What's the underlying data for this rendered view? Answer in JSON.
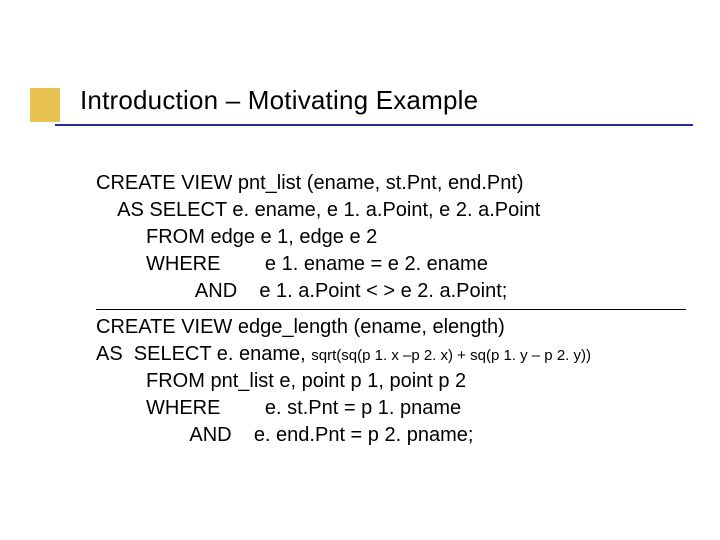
{
  "title": "Introduction – Motivating Example",
  "lines": {
    "l1": "CREATE VIEW pnt_list (ename, st.Pnt, end.Pnt)",
    "l2": "    AS SELECT e. ename, e 1. a.Point, e 2. a.Point",
    "l3": "         FROM edge e 1, edge e 2",
    "l4": "         WHERE        e 1. ename = e 2. ename",
    "l5": "                  AND    e 1. a.Point < > e 2. a.Point;",
    "l6a": "CREATE VIEW edge_length (ename, elength)",
    "l6b_prefix": "AS  SELECT e. ename, ",
    "l6b_small": "sqrt(sq(p 1. x –p 2. x) + sq(p 1. y – p 2. y))",
    "l7": "         FROM pnt_list e, point p 1, point p 2",
    "l8": "         WHERE        e. st.Pnt = p 1. pname",
    "l9": "                 AND    e. end.Pnt = p 2. pname;"
  }
}
